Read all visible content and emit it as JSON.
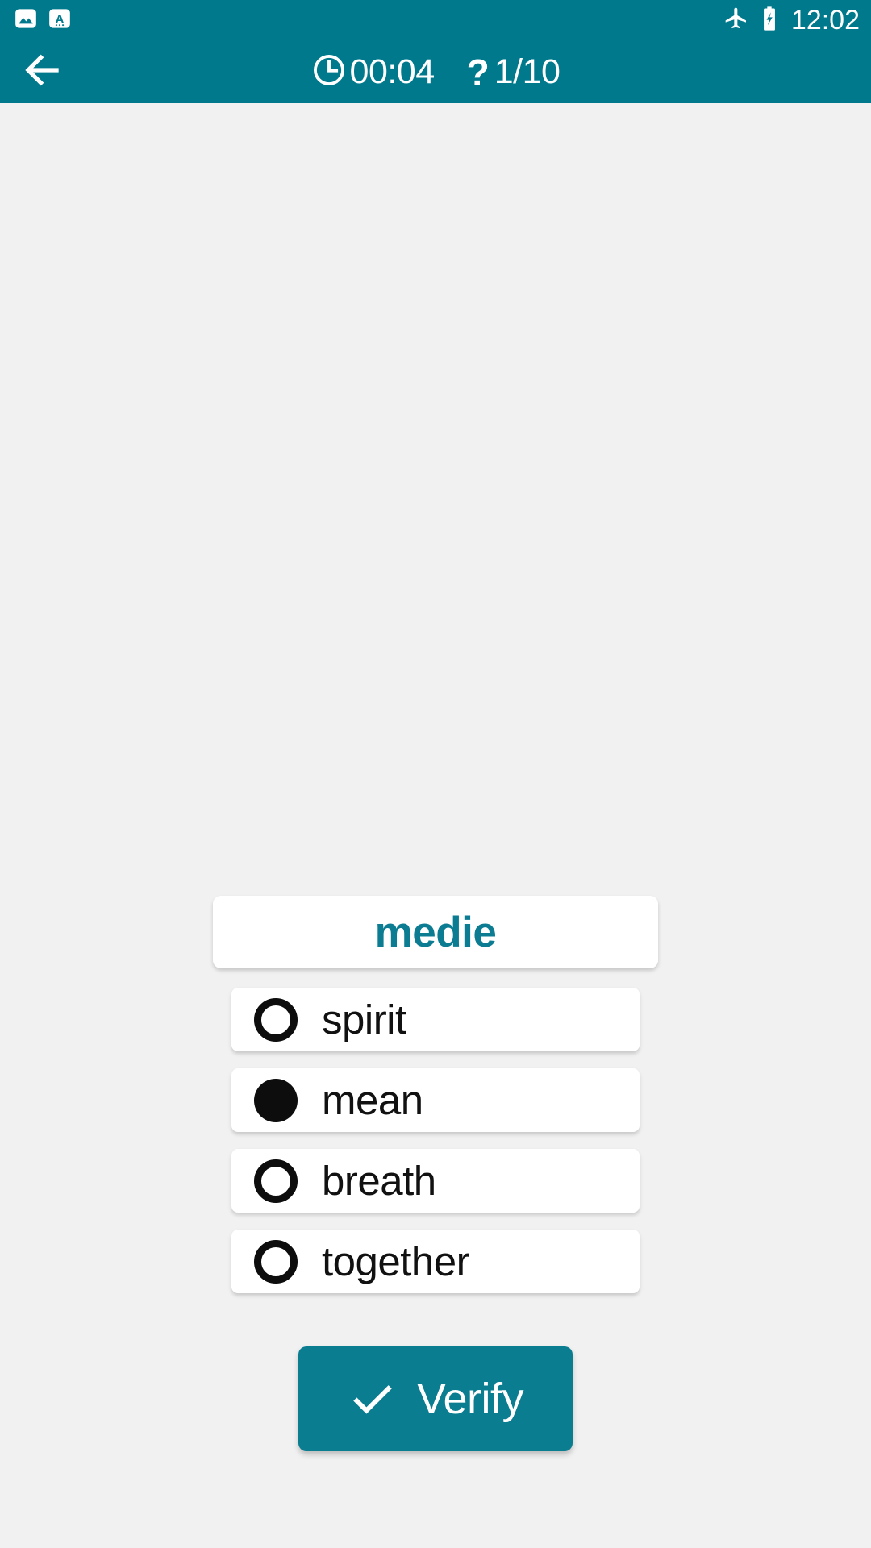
{
  "theme": {
    "primary": "#00798c",
    "accent": "#0b7c91",
    "background": "#f1f1f1",
    "card": "#ffffff",
    "text": "#111111",
    "on_primary": "#ffffff"
  },
  "status_bar": {
    "left_icons": [
      {
        "name": "image-icon",
        "label": "image"
      },
      {
        "name": "text-a-icon",
        "label": "A"
      }
    ],
    "right_icons": [
      {
        "name": "airplane-mode-icon",
        "label": "airplane mode"
      },
      {
        "name": "battery-charging-icon",
        "label": "battery charging"
      }
    ],
    "clock": "12:02"
  },
  "app_bar": {
    "back_label": "Back",
    "timer_icon": "clock-icon",
    "timer": "00:04",
    "counter_icon": "question-mark-icon",
    "counter": "1/10"
  },
  "quiz": {
    "word": "medie",
    "options": [
      {
        "label": "spirit",
        "selected": false
      },
      {
        "label": "mean",
        "selected": true
      },
      {
        "label": "breath",
        "selected": false
      },
      {
        "label": "together",
        "selected": false
      }
    ],
    "verify_label": "Verify",
    "verify_icon": "check-icon"
  }
}
